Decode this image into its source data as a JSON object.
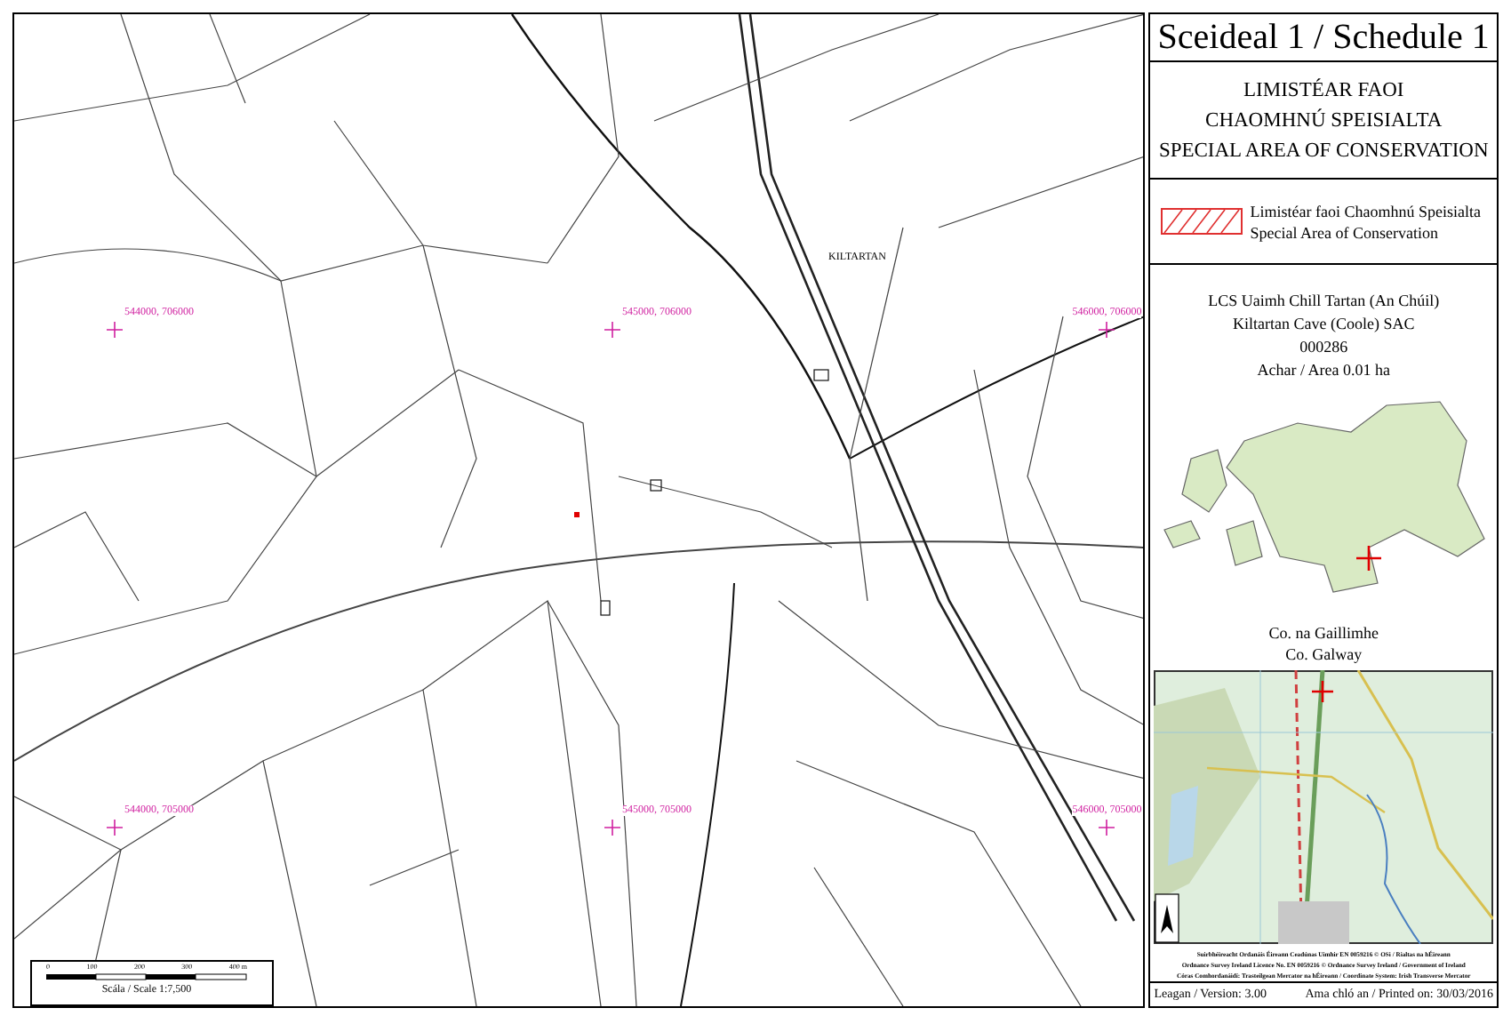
{
  "map": {
    "place_label": "KILTARTAN",
    "grid_labels": [
      {
        "text": "544000, 706000"
      },
      {
        "text": "545000, 706000"
      },
      {
        "text": "546000, 706000"
      },
      {
        "text": "544000, 705000"
      },
      {
        "text": "545000, 705000"
      },
      {
        "text": "546000, 705000"
      }
    ],
    "scale": {
      "ticks": [
        "0",
        "100",
        "200",
        "300",
        "400 m"
      ],
      "caption": "Scála / Scale 1:7,500"
    }
  },
  "panel": {
    "title": "Sceideal 1 / Schedule 1",
    "heading": [
      "LIMISTÉAR FAOI",
      "CHAOMHNÚ SPEISIALTA",
      "SPECIAL AREA OF CONSERVATION"
    ],
    "legend": [
      "Limistéar faoi Chaomhnú Speisialta",
      "Special Area of Conservation"
    ],
    "site": [
      "LCS Uaimh Chill Tartan (An Chúil)",
      "Kiltartan Cave (Coole) SAC",
      "000286",
      "Achar / Area 0.01 ha"
    ],
    "county": [
      "Co. na Gaillimhe",
      "Co. Galway"
    ],
    "copyright": [
      "Suirbhéireacht Ordanáis Éireann Ceadúnas Uimhir EN 0059216 © OSi / Rialtas na hÉireann",
      "Ordnance Survey Ireland Licence No. EN 0059216 © Ordnance Survey Ireland / Government of Ireland",
      "Córas Comhordanáidí: Trasteilgean Mercator na hÉireann / Coordinate System: Irish Transverse Mercator"
    ],
    "version": "Leagan / Version: 3.00",
    "printed": "Ama chló an / Printed on: 30/03/2016"
  }
}
